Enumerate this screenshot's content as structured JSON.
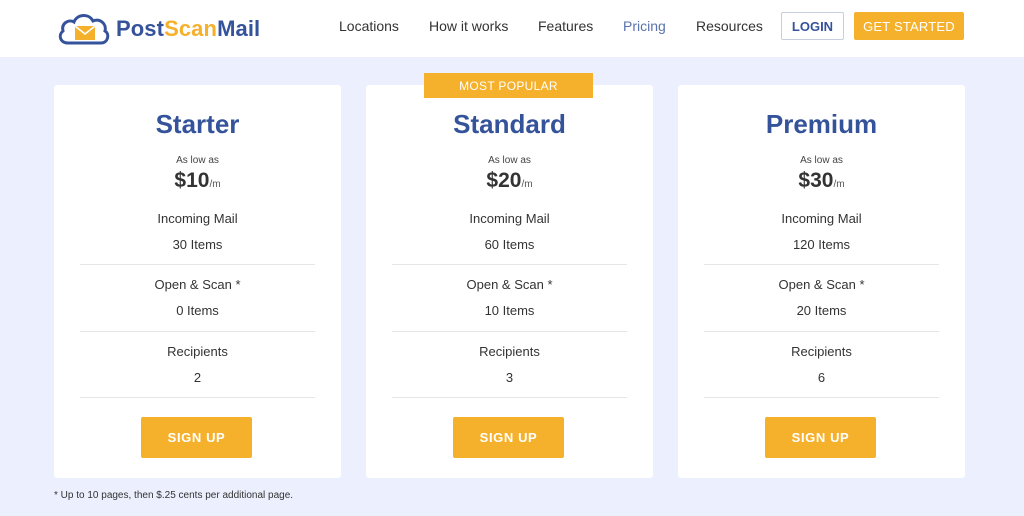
{
  "header": {
    "logo_part1": "Post",
    "logo_part2": "Scan",
    "logo_part3": "Mail",
    "nav": [
      {
        "label": "Locations"
      },
      {
        "label": "How it works"
      },
      {
        "label": "Features"
      },
      {
        "label": "Pricing"
      },
      {
        "label": "Resources"
      }
    ],
    "login_label": "LOGIN",
    "get_started_label": "GET STARTED"
  },
  "colors": {
    "brand_blue": "#35539b",
    "accent_yellow": "#f5b12c",
    "background": "#eceffd"
  },
  "badge": "MOST POPULAR",
  "plans": [
    {
      "name": "Starter",
      "as_low_as": "As low as",
      "price": "$10",
      "per": "/m",
      "incoming_label": "Incoming Mail",
      "incoming_value": "30 Items",
      "scan_label": "Open & Scan *",
      "scan_value": "0 Items",
      "recipients_label": "Recipients",
      "recipients_value": "2",
      "cta": "SIGN UP"
    },
    {
      "name": "Standard",
      "as_low_as": "As low as",
      "price": "$20",
      "per": "/m",
      "incoming_label": "Incoming Mail",
      "incoming_value": "60 Items",
      "scan_label": "Open & Scan *",
      "scan_value": "10 Items",
      "recipients_label": "Recipients",
      "recipients_value": "3",
      "cta": "SIGN UP"
    },
    {
      "name": "Premium",
      "as_low_as": "As low as",
      "price": "$30",
      "per": "/m",
      "incoming_label": "Incoming Mail",
      "incoming_value": "120 Items",
      "scan_label": "Open & Scan *",
      "scan_value": "20 Items",
      "recipients_label": "Recipients",
      "recipients_value": "6",
      "cta": "SIGN UP"
    }
  ],
  "footnote": "* Up to 10 pages, then $.25 cents per additional page."
}
